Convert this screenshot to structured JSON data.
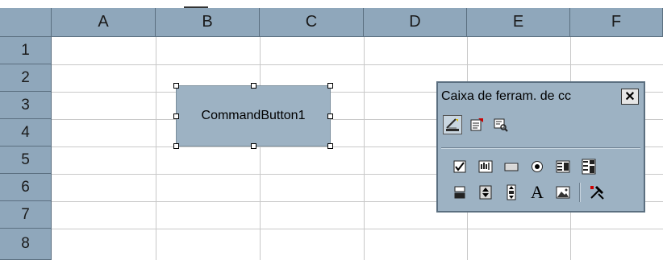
{
  "spreadsheet": {
    "columns": [
      "A",
      "B",
      "C",
      "D",
      "E",
      "F"
    ],
    "rows": [
      "1",
      "2",
      "3",
      "4",
      "5",
      "6",
      "7",
      "8"
    ]
  },
  "command_button": {
    "label": "CommandButton1"
  },
  "toolbox": {
    "title": "Caixa de ferram. de cc",
    "close_label": "✕",
    "top_tools": [
      "design-mode-icon",
      "properties-icon",
      "view-code-icon"
    ],
    "controls_row1": [
      "checkbox-icon",
      "textbox-icon",
      "command-button-icon",
      "option-button-icon",
      "listbox-icon",
      "combobox-icon"
    ],
    "controls_row2": [
      "toggle-button-icon",
      "spin-button-icon",
      "scrollbar-icon",
      "label-icon",
      "image-icon",
      "more-controls-icon"
    ],
    "label_glyph": "A"
  }
}
